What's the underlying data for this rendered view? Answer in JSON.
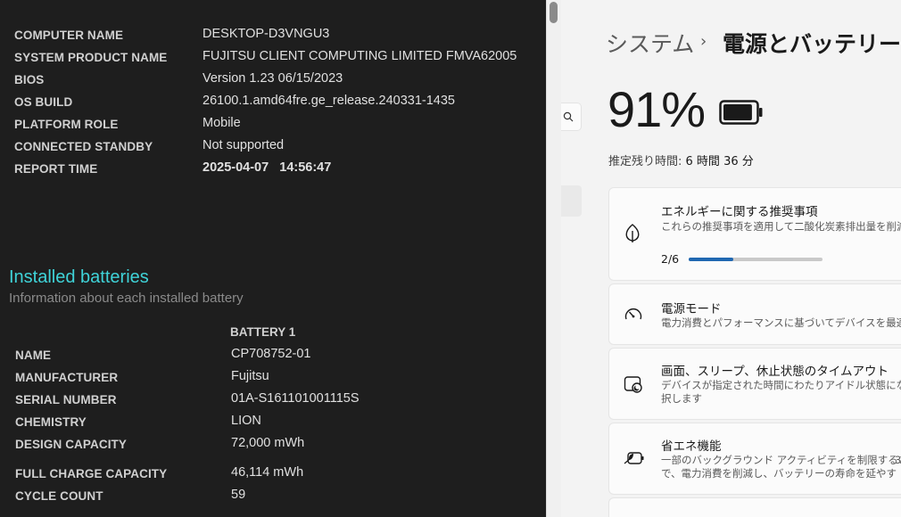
{
  "report": {
    "system_info": [
      {
        "key": "COMPUTER NAME",
        "value": "DESKTOP-D3VNGU3"
      },
      {
        "key": "SYSTEM PRODUCT NAME",
        "value": "FUJITSU CLIENT COMPUTING LIMITED FMVA62005"
      },
      {
        "key": "BIOS",
        "value": "Version 1.23 06/15/2023"
      },
      {
        "key": "OS BUILD",
        "value": "26100.1.amd64fre.ge_release.240331-1435"
      },
      {
        "key": "PLATFORM ROLE",
        "value": "Mobile"
      },
      {
        "key": "CONNECTED STANDBY",
        "value": "Not supported"
      },
      {
        "key": "REPORT TIME",
        "value": "2025-04-07   14:56:47"
      }
    ],
    "installed_title": "Installed batteries",
    "installed_subtitle": "Information about each installed battery",
    "battery_column": "BATTERY 1",
    "battery_info": [
      {
        "key": "NAME",
        "value": "CP708752-01"
      },
      {
        "key": "MANUFACTURER",
        "value": "Fujitsu"
      },
      {
        "key": "SERIAL NUMBER",
        "value": "01A-S161101001115S"
      },
      {
        "key": "CHEMISTRY",
        "value": "LION"
      },
      {
        "key": "DESIGN CAPACITY",
        "value": "72,000 mWh"
      },
      {
        "key": "FULL CHARGE CAPACITY",
        "value": "46,114 mWh"
      },
      {
        "key": "CYCLE COUNT",
        "value": "59"
      }
    ]
  },
  "settings": {
    "breadcrumb_parent": "システム",
    "breadcrumb_sep": "›",
    "breadcrumb_current": "電源とバッテリー",
    "battery_percent": "91%",
    "battery_level": 0.91,
    "remaining_label": "推定残り時間:",
    "remaining_value": "6 時間 36 分",
    "cards": {
      "energy": {
        "title": "エネルギーに関する推奨事項",
        "desc": "これらの推奨事項を適用して二酸化炭素排出量を削減す",
        "progress_text": "2/6",
        "progress_fraction": 0.333
      },
      "power_mode": {
        "title": "電源モード",
        "desc": "電力消費とパフォーマンスに基づいてデバイスを最適化"
      },
      "timeout": {
        "title": "画面、スリープ、休止状態のタイムアウト",
        "desc1": "デバイスが指定された時間にわたりアイドル状態になった場",
        "desc2": "択します"
      },
      "saver": {
        "title": "省エネ機能",
        "desc1": "一部のバックグラウンド アクティビティを制限すること",
        "desc2": "で、電力消費を削減し、バッテリーの寿命を延やす",
        "extra": "3"
      }
    }
  },
  "colors": {
    "accent": "#1f67b1",
    "report_heading": "#3fd3d8",
    "report_bg": "#1e1e1e"
  }
}
